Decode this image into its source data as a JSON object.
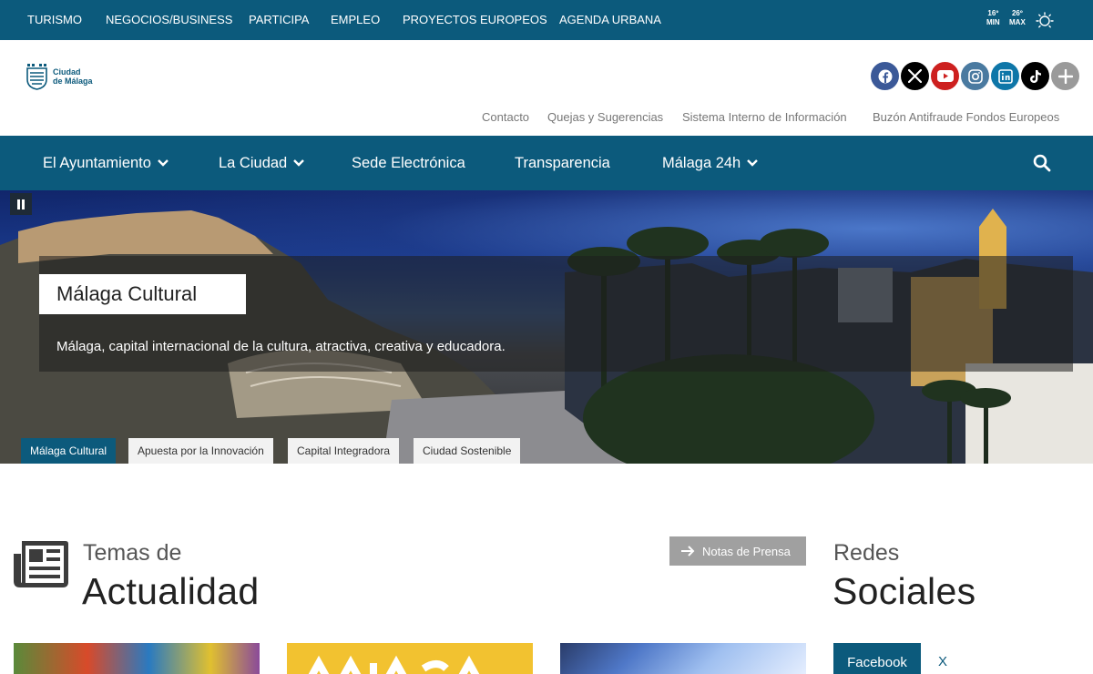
{
  "topbar": {
    "links": [
      "TURISMO",
      "NEGOCIOS/BUSINESS",
      "PARTICIPA",
      "EMPLEO",
      "PROYECTOS EUROPEOS",
      "AGENDA URBANA"
    ],
    "weather": {
      "min_value": "16º",
      "min_label": "MIN",
      "max_value": "26º",
      "max_label": "MAX",
      "icon": "sun-icon"
    }
  },
  "header": {
    "logo": {
      "line1": "Ciudad",
      "line2": "de Málaga"
    },
    "social": [
      {
        "name": "facebook-icon",
        "color": "#3b5998"
      },
      {
        "name": "x-icon",
        "color": "#000000"
      },
      {
        "name": "youtube-icon",
        "color": "#cd201f"
      },
      {
        "name": "instagram-icon",
        "color": "#4a7aa0"
      },
      {
        "name": "linkedin-icon",
        "color": "#0e76a8"
      },
      {
        "name": "tiktok-icon",
        "color": "#000000"
      },
      {
        "name": "plus-icon",
        "color": "#9a9a9a"
      }
    ],
    "links": [
      "Contacto",
      "Quejas y Sugerencias",
      "Sistema Interno de Información",
      "Buzón Antifraude Fondos Europeos"
    ]
  },
  "nav": {
    "items": [
      {
        "label": "El Ayuntamiento"
      },
      {
        "label": "La Ciudad"
      },
      {
        "label": "Sede Electrónica"
      },
      {
        "label": "Transparencia"
      },
      {
        "label": "Málaga 24h"
      }
    ]
  },
  "hero": {
    "title": "Málaga Cultural",
    "text": "Málaga, capital internacional de la cultura, atractiva, creativa y educadora.",
    "tabs": [
      "Málaga Cultural",
      "Apuesta por la Innovación",
      "Capital Integradora",
      "Ciudad Sostenible"
    ],
    "active_tab": 0
  },
  "news": {
    "pre": "Temas de",
    "main": "Actualidad",
    "press_button": "Notas de Prensa"
  },
  "social_section": {
    "pre": "Redes",
    "main": "Sociales",
    "tabs": [
      "Facebook",
      "X"
    ]
  },
  "colors": {
    "brand": "#0c5a7c",
    "press_button": "#a0a0a0"
  }
}
